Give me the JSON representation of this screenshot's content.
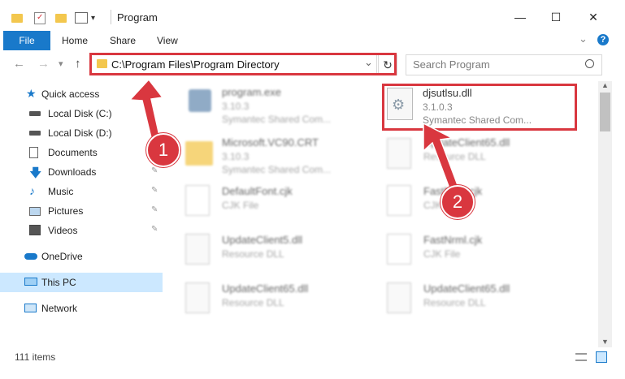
{
  "window": {
    "title": "Program",
    "minimize_label": "—",
    "maximize_label": "☐",
    "close_label": "✕"
  },
  "ribbon": {
    "tabs": [
      {
        "label": "File"
      },
      {
        "label": "Home"
      },
      {
        "label": "Share"
      },
      {
        "label": "View"
      }
    ],
    "expand_icon": "chevron-down-icon",
    "help_label": "?"
  },
  "navigation": {
    "back_label": "←",
    "forward_label": "→",
    "recent_label": "▾",
    "up_label": "↑"
  },
  "address": {
    "path": "C:\\Program Files\\Program Directory",
    "dropdown_label": "⌄",
    "refresh_label": "↻"
  },
  "search": {
    "placeholder": "Search Program"
  },
  "sidebar": {
    "items": [
      {
        "label": "Quick access",
        "icon": "star-icon",
        "pinned": false
      },
      {
        "label": "Local Disk (C:)",
        "icon": "drive-icon",
        "pinned": false
      },
      {
        "label": "Local Disk (D:)",
        "icon": "drive-icon",
        "pinned": false
      },
      {
        "label": "Documents",
        "icon": "documents-icon",
        "pinned": false
      },
      {
        "label": "Downloads",
        "icon": "download-icon",
        "pinned": true
      },
      {
        "label": "Music",
        "icon": "music-icon",
        "pinned": true
      },
      {
        "label": "Pictures",
        "icon": "pictures-icon",
        "pinned": true
      },
      {
        "label": "Videos",
        "icon": "videos-icon",
        "pinned": true
      },
      {
        "label": "OneDrive",
        "icon": "cloud-icon",
        "pinned": false
      },
      {
        "label": "This PC",
        "icon": "computer-icon",
        "pinned": false,
        "selected": true
      },
      {
        "label": "Network",
        "icon": "network-icon",
        "pinned": false
      }
    ],
    "pin_symbol": "📌"
  },
  "files": [
    {
      "name": "program.exe",
      "version": "3.10.3",
      "company": "Symantec Shared Com...",
      "type": "exe"
    },
    {
      "name": "djsutlsu.dll",
      "version": "3.1.0.3",
      "company": "Symantec Shared Com...",
      "type": "dll"
    },
    {
      "name": "Microsoft.VC90.CRT",
      "version": "3.10.3",
      "company": "Symantec Shared Com...",
      "type": "folder"
    },
    {
      "name": "UpdateClient65.dll",
      "version": "Resource DLL",
      "company": "",
      "type": "dll"
    },
    {
      "name": "DefaultFont.cjk",
      "version": "CJK File",
      "company": "",
      "type": "file"
    },
    {
      "name": "FastNrml.cjk",
      "version": "CJK File",
      "company": "",
      "type": "file"
    },
    {
      "name": "UpdateClient5.dll",
      "version": "Resource DLL",
      "company": "",
      "type": "dll"
    },
    {
      "name": "FastNrml.cjk",
      "version": "CJK File",
      "company": "",
      "type": "file"
    },
    {
      "name": "UpdateClient65.dll",
      "version": "Resource DLL",
      "company": "",
      "type": "dll"
    },
    {
      "name": "UpdateClient65.dll",
      "version": "Resource DLL",
      "company": "",
      "type": "dll"
    }
  ],
  "status": {
    "item_count": "111 items"
  },
  "callouts": [
    "1",
    "2"
  ],
  "colors": {
    "accent": "#1979ca",
    "highlight": "#d9373f",
    "selected": "#cce8ff"
  }
}
